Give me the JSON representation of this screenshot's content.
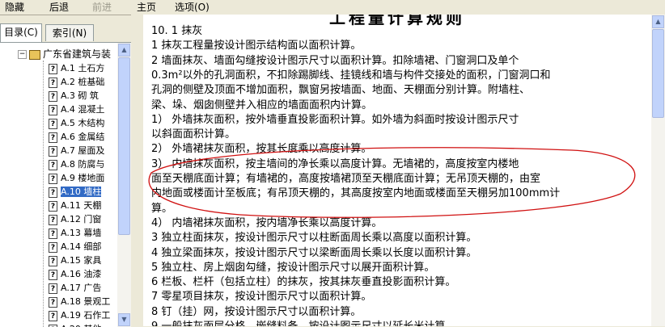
{
  "toolbar": {
    "hide_label": "隐藏",
    "back_label": "后退",
    "forward_label": "前进",
    "home_label": "主页",
    "options_label": "选项(O)"
  },
  "tabs": {
    "contents": "目录(C)",
    "index": "索引(N)"
  },
  "tree": {
    "root_label": "广东省建筑与装",
    "selected_index": 9,
    "items": [
      {
        "label": "A.1  土石方"
      },
      {
        "label": "A.2  桩基础"
      },
      {
        "label": "A.3  砌  筑"
      },
      {
        "label": "A.4  混凝土"
      },
      {
        "label": "A.5  木结构"
      },
      {
        "label": "A.6  金属结"
      },
      {
        "label": "A.7  屋面及"
      },
      {
        "label": "A.8  防腐与"
      },
      {
        "label": "A.9  楼地面"
      },
      {
        "label": "A.10  墙柱"
      },
      {
        "label": "A.11  天棚"
      },
      {
        "label": "A.12  门窗"
      },
      {
        "label": "A.13  幕墙"
      },
      {
        "label": "A.14  细部"
      },
      {
        "label": "A.15  家具"
      },
      {
        "label": "A.16  油漆"
      },
      {
        "label": "A.17  广告"
      },
      {
        "label": "A.18  景观工"
      },
      {
        "label": "A.19  石作工"
      },
      {
        "label": "A.20  其他"
      }
    ]
  },
  "content": {
    "title": "工程量计算规则",
    "lines": [
      "10. 1   抹灰",
      "     1   抹灰工程量按设计图示结构面以面积计算。",
      "     2   墙面抹灰、墙面勾缝按设计图示尺寸以面积计算。扣除墙裙、门窗洞口及单个",
      "0.3m²以外的孔洞面积，不扣除踢脚线、挂镜线和墙与构件交接处的面积，门窗洞口和",
      "孔洞的侧壁及顶面不增加面积，飘窗另按墙面、地面、天棚面分别计算。附墙柱、",
      "梁、垛、烟囱侧壁并入相应的墙面面积内计算。",
      "     1）  外墙抹灰面积，按外墙垂直投影面积计算。如外墙为斜面时按设计图示尺寸",
      "以斜面面积计算。",
      "     2）  外墙裙抹灰面积，按其长度乘以高度计算。",
      "     3）  内墙抹灰面积，按主墙间的净长乘以高度计算。无墙裙的，高度按室内楼地",
      "面至天棚底面计算；有墙裙的，高度按墙裙顶至天棚底面计算；无吊顶天棚的，由室",
      "内地面或楼面计至板底；有吊顶天棚的，其高度按室内地面或楼面至天棚另加100mm计",
      "算。",
      "     4）  内墙裙抹灰面积，按内墙净长乘以高度计算。",
      "     3   独立柱面抹灰，按设计图示尺寸以柱断面周长乘以高度以面积计算。",
      "     4   独立梁面抹灰，按设计图示尺寸以梁断面周长乘以长度以面积计算。",
      "     5   独立柱、房上烟囱勾缝，按设计图示尺寸以展开面积计算。",
      "     6   栏板、栏杆（包括立柱）的抹灰，按其抹灰垂直投影面积计算。",
      "     7   零星项目抹灰，按设计图示尺寸以面积计算。",
      "     8   钉（挂）网，按设计图示尺寸以面积计算。",
      "     9   一般抹灰面层分格、嵌缝料备，按设计图示尺寸以延长米计算。"
    ]
  },
  "colors": {
    "annotation": "#d01010",
    "selection": "#316ac5"
  }
}
